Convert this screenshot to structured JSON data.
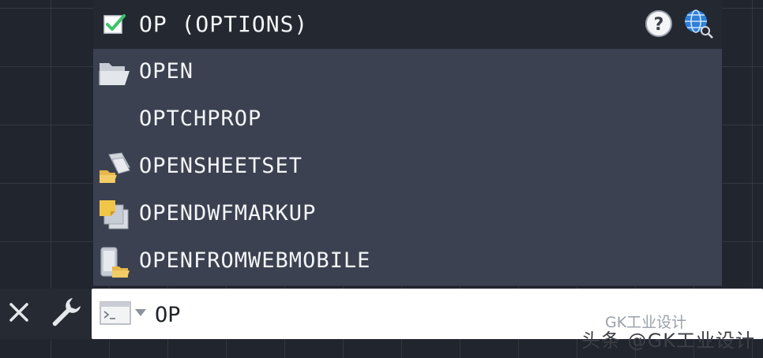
{
  "header": {
    "checked": true,
    "title": "OP (OPTIONS)",
    "help_icon": "question-circle-icon",
    "search_icon": "globe-search-icon"
  },
  "suggestions": [
    {
      "label": "OPEN",
      "icon": "open-folder-icon"
    },
    {
      "label": "OPTCHPROP",
      "icon": ""
    },
    {
      "label": "OPENSHEETSET",
      "icon": "sheetset-folder-icon"
    },
    {
      "label": "OPENDWFMARKUP",
      "icon": "dwf-markup-icon"
    },
    {
      "label": "OPENFROMWEBMOBILE",
      "icon": "mobile-folder-icon"
    }
  ],
  "command_line": {
    "close_icon": "close-icon",
    "customize_icon": "wrench-icon",
    "prompt_icon": "terminal-icon",
    "value": "OP"
  },
  "watermark": {
    "small": "GK工业设计",
    "main": "头条 @GK工业设计"
  },
  "colors": {
    "background": "#21252d",
    "list_bg": "#3b4150",
    "header_bg": "#232831",
    "check": "#3cc36b",
    "folder": "#e6b84a"
  }
}
